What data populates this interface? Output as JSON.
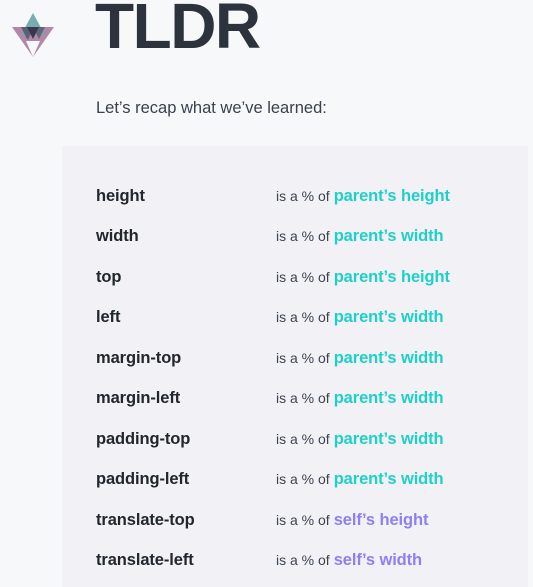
{
  "header": {
    "title": "TLDR",
    "subtitle": "Let’s recap what we’ve learned:",
    "logo_name": "triangles-logo-icon"
  },
  "panel": {
    "connector_text": "is a % of",
    "rows": [
      {
        "property": "height",
        "connector": "is a % of",
        "target": "parent’s height",
        "scope": "parent"
      },
      {
        "property": "width",
        "connector": "is a % of",
        "target": "parent’s width",
        "scope": "parent"
      },
      {
        "property": "top",
        "connector": "is a % of",
        "target": "parent’s height",
        "scope": "parent"
      },
      {
        "property": "left",
        "connector": "is a % of",
        "target": "parent’s width",
        "scope": "parent"
      },
      {
        "property": "margin-top",
        "connector": "is a % of",
        "target": "parent’s width",
        "scope": "parent"
      },
      {
        "property": "margin-left",
        "connector": "is a % of",
        "target": "parent’s width",
        "scope": "parent"
      },
      {
        "property": "padding-top",
        "connector": "is a % of",
        "target": "parent’s width",
        "scope": "parent"
      },
      {
        "property": "padding-left",
        "connector": "is a % of",
        "target": "parent’s width",
        "scope": "parent"
      },
      {
        "property": "translate-top",
        "connector": "is a % of",
        "target": "self’s height",
        "scope": "self"
      },
      {
        "property": "translate-left",
        "connector": "is a % of",
        "target": "self’s width",
        "scope": "self"
      }
    ]
  },
  "colors": {
    "page_background": "#f7f8fa",
    "panel_background": "#f2f1f6",
    "title": "#2d333c",
    "property": "#22262d",
    "connector": "#3c4450",
    "parent_accent": "#1fd0c9",
    "self_accent": "#8f80f2",
    "logo_mauve": "#b287a8",
    "logo_teal": "#6fa9ab",
    "logo_slate": "#5a6272",
    "logo_plum": "#3d3450"
  }
}
